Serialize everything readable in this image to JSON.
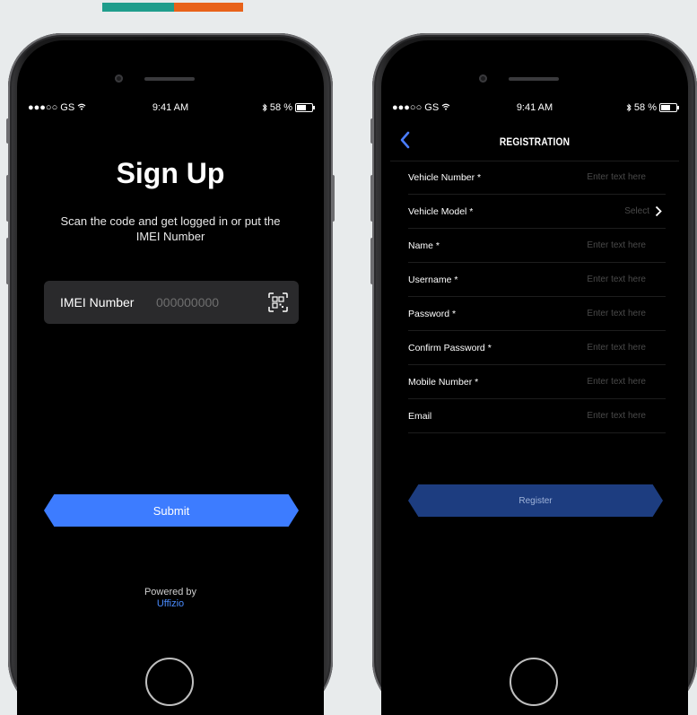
{
  "colors": {
    "accent_teal": "#1f9d8c",
    "accent_orange": "#e8621a",
    "primary_blue": "#3d7cff",
    "register_blue": "#1d3d80"
  },
  "status_bar": {
    "carrier": "●●●○○ GS",
    "time": "9:41 AM",
    "battery": "58 %"
  },
  "signup": {
    "title": "Sign Up",
    "subtitle": "Scan the code and get logged in or put the IMEI Number",
    "imei_label": "IMEI Number",
    "imei_placeholder": "000000000",
    "submit_label": "Submit",
    "powered_by": "Powered by",
    "brand": "Uffizio"
  },
  "registration": {
    "title": "REGISTRATION",
    "fields": [
      {
        "label": "Vehicle Number *",
        "placeholder": "Enter text here"
      },
      {
        "label": "Vehicle Model *",
        "select_text": "Select"
      },
      {
        "label": "Name *",
        "placeholder": "Enter text here"
      },
      {
        "label": "Username *",
        "placeholder": "Enter text here"
      },
      {
        "label": "Password *",
        "placeholder": "Enter text here"
      },
      {
        "label": "Confirm Password *",
        "placeholder": "Enter text here"
      },
      {
        "label": "Mobile Number *",
        "placeholder": "Enter text here"
      },
      {
        "label": "Email",
        "placeholder": "Enter text here"
      }
    ],
    "register_label": "Register"
  }
}
